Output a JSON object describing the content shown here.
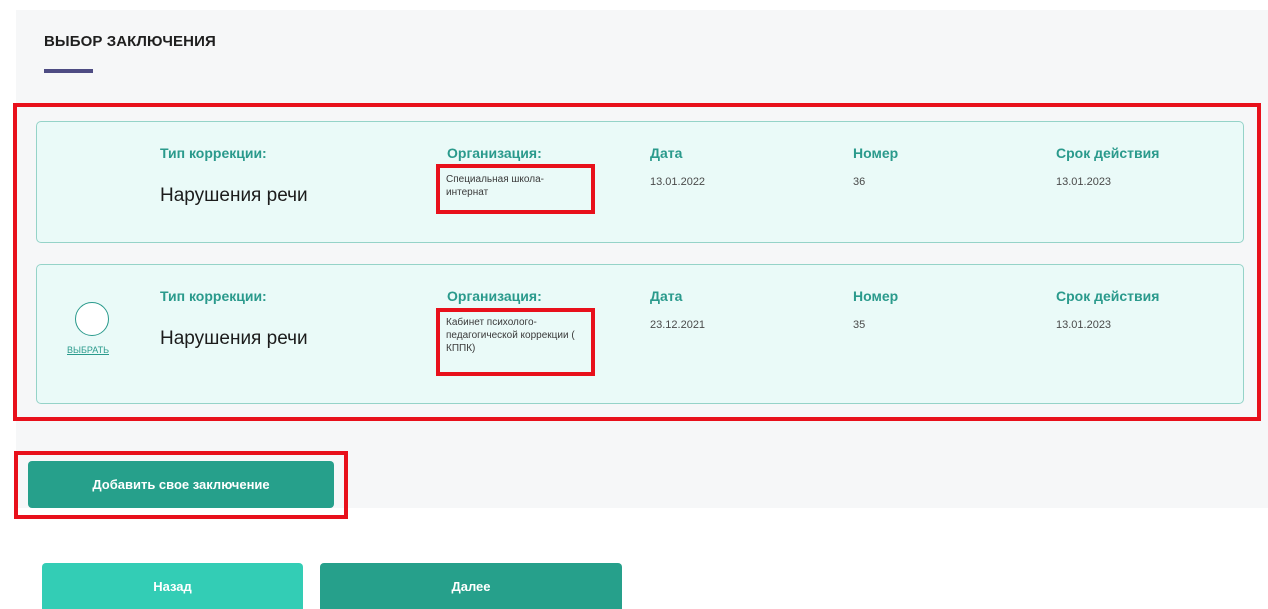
{
  "section": {
    "title": "ВЫБОР ЗАКЛЮЧЕНИЯ"
  },
  "labels": {
    "type": "Тип коррекции:",
    "organization": "Организация:",
    "date": "Дата",
    "number": "Номер",
    "expiry": "Срок действия"
  },
  "cards": [
    {
      "type": "Нарушения речи",
      "organization": "Специальная школа-интернат",
      "date": "13.01.2022",
      "number": "36",
      "expiry": "13.01.2023"
    },
    {
      "type": "Нарушения речи",
      "organization": "Кабинет психолого-педагогической коррекции ( КППК)",
      "date": "23.12.2021",
      "number": "35",
      "expiry": "13.01.2023",
      "select_label": "ВЫБРАТЬ"
    }
  ],
  "buttons": {
    "add": "Добавить свое заключение",
    "back": "Назад",
    "next": "Далее"
  },
  "colors": {
    "accent": "#2a9a8c",
    "button_primary": "#26a08b",
    "button_secondary": "#33cdb5",
    "card_bg": "#eafaf8",
    "highlight": "#e8101b",
    "title_underline": "#4e4c83"
  }
}
